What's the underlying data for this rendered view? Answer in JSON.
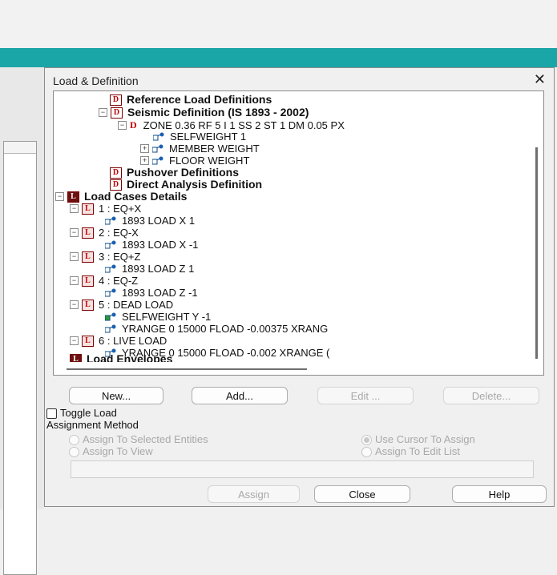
{
  "dialog": {
    "title": "Load & Definition",
    "close_glyph": "✕"
  },
  "tree": {
    "definitions": [
      {
        "label": "Reference Load Definitions",
        "icon": "definition-icon"
      },
      {
        "label": "Seismic Definition (IS 1893 - 2002)",
        "icon": "definition-icon"
      },
      {
        "label": "ZONE 0.36 RF 5 I 1 SS 2 ST 1 DM 0.05 PX",
        "icon": "definition-icon"
      },
      {
        "label": "SELFWEIGHT 1",
        "icon": "load-item-icon"
      },
      {
        "label": "MEMBER WEIGHT",
        "icon": "load-item-icon"
      },
      {
        "label": "FLOOR WEIGHT",
        "icon": "load-item-icon"
      },
      {
        "label": "Pushover Definitions",
        "icon": "definition-icon"
      },
      {
        "label": "Direct Analysis Definition",
        "icon": "definition-icon"
      }
    ],
    "load_cases_header": "Load Cases Details",
    "load_cases": [
      {
        "label": "1 : EQ+X",
        "items": [
          "1893 LOAD X 1"
        ]
      },
      {
        "label": "2 : EQ-X",
        "items": [
          "1893 LOAD X -1"
        ]
      },
      {
        "label": "3 : EQ+Z",
        "items": [
          "1893 LOAD Z 1"
        ]
      },
      {
        "label": "4 : EQ-Z",
        "items": [
          "1893 LOAD Z -1"
        ]
      },
      {
        "label": "5 : DEAD LOAD",
        "items": [
          "SELFWEIGHT Y -1",
          "YRANGE 0 15000 FLOAD -0.00375 XRANG"
        ]
      },
      {
        "label": "6 : LIVE LOAD",
        "items": [
          "YRANGE 0 15000 FLOAD -0.002 XRANGE ("
        ]
      }
    ],
    "load_envelopes": "Load Envelopes",
    "expand_collapsed": "+",
    "expand_open": "−"
  },
  "buttons": {
    "new": "New...",
    "add": "Add...",
    "edit": "Edit ...",
    "delete": "Delete..."
  },
  "toggle_load": "Toggle Load",
  "assignment": {
    "group_label": "Assignment Method",
    "options": {
      "assign_selected": "Assign To Selected Entities",
      "use_cursor": "Use Cursor To Assign",
      "assign_view": "Assign To View",
      "assign_edit_list": "Assign To Edit List"
    },
    "selected": "use_cursor"
  },
  "footer": {
    "assign": "Assign",
    "close": "Close",
    "help": "Help"
  },
  "colors": {
    "title_bar_accent": "#1aa6a6",
    "definition_icon": "#c00000"
  }
}
